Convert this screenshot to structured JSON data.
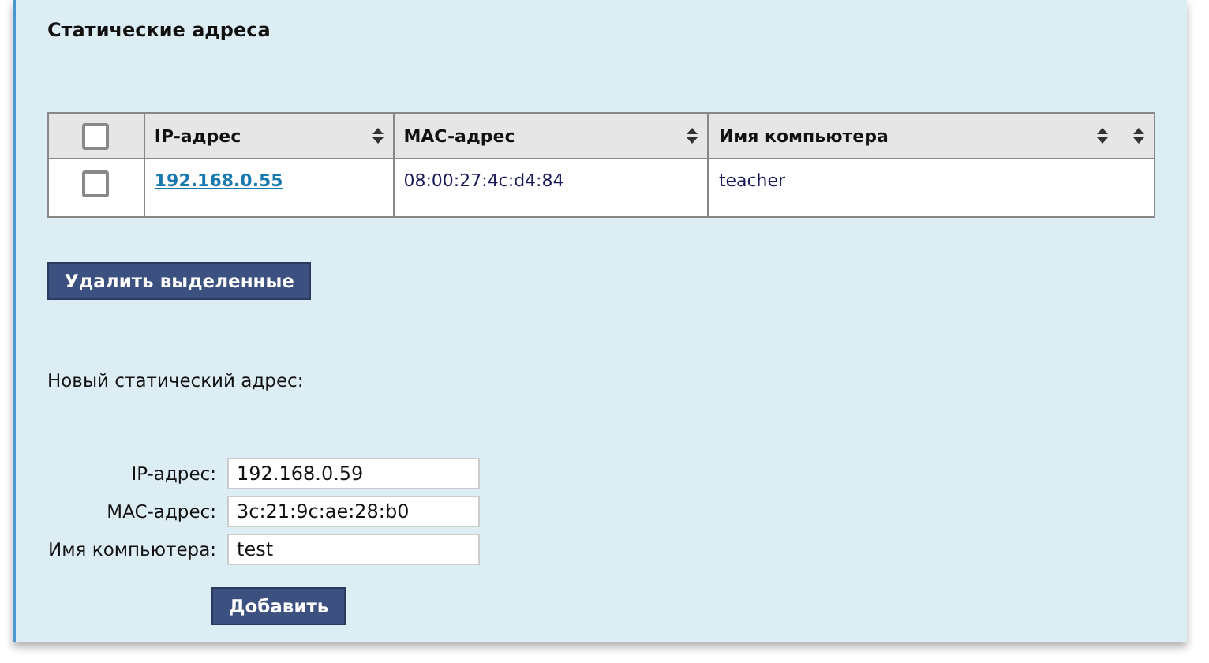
{
  "section_title": "Статические адреса",
  "table": {
    "select_all": {
      "checked": false
    },
    "columns": [
      {
        "label": "IP-адрес",
        "extra_sort_icon": false
      },
      {
        "label": "MAC-адрес",
        "extra_sort_icon": false
      },
      {
        "label": "Имя компьютера",
        "extra_sort_icon": true
      }
    ],
    "rows": [
      {
        "checked": false,
        "ip": "192.168.0.55",
        "mac": "08:00:27:4c:d4:84",
        "hostname": "teacher"
      }
    ]
  },
  "delete_button": "Удалить выделенные",
  "new_title": "Новый статический адрес:",
  "fields": [
    {
      "label": "IP-адрес:",
      "value": "192.168.0.59"
    },
    {
      "label": "MAC-адрес:",
      "value": "3c:21:9c:ae:28:b0"
    },
    {
      "label": "Имя компьютера:",
      "value": "test"
    }
  ],
  "add_button": "Добавить"
}
